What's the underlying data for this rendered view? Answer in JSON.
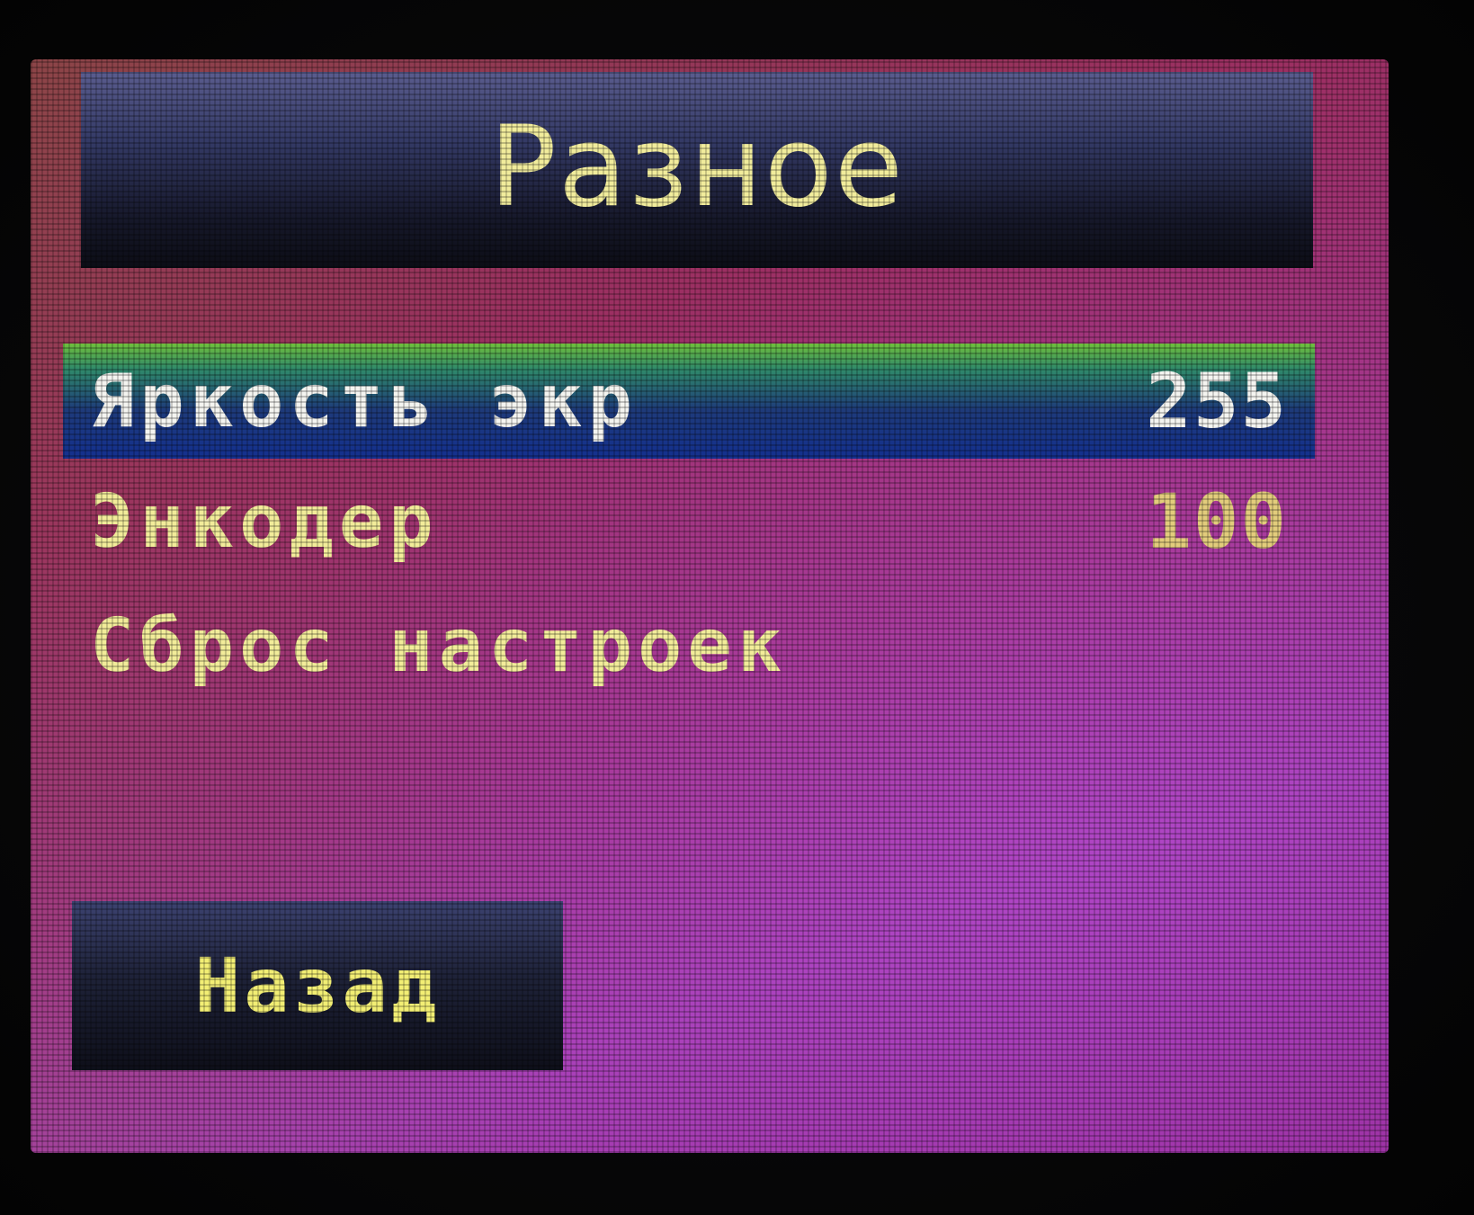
{
  "header": {
    "title": "Разное"
  },
  "menu": {
    "items": [
      {
        "label": "Яркость экр",
        "value": "255",
        "selected": true
      },
      {
        "label": "Энкодер",
        "value": "100",
        "selected": false
      },
      {
        "label": "Сброс настроек",
        "value": "",
        "selected": false
      }
    ]
  },
  "footer": {
    "back_label": "Назад"
  },
  "colors": {
    "text_yellow": "#f2ec9a",
    "selected_text": "#f4f4f0",
    "selection_bar": "#14308f",
    "header_bar": "#16182a"
  }
}
